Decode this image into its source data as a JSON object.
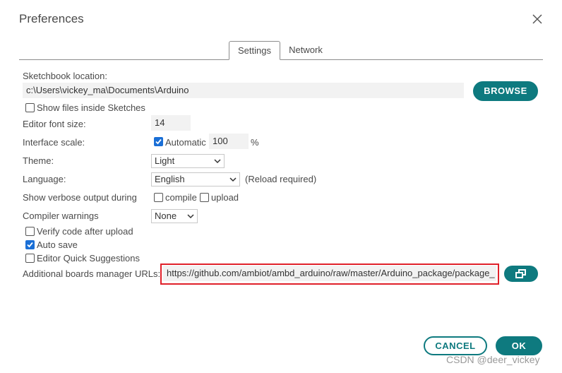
{
  "dialog": {
    "title": "Preferences",
    "close_icon": "close-icon"
  },
  "tabs": [
    {
      "label": "Settings",
      "active": true
    },
    {
      "label": "Network",
      "active": false
    }
  ],
  "settings": {
    "sketchbook_label": "Sketchbook location:",
    "sketchbook_value": "c:\\Users\\vickey_ma\\Documents\\Arduino",
    "browse_label": "BROWSE",
    "show_files_label": "Show files inside Sketches",
    "show_files_checked": false,
    "font_size_label": "Editor font size:",
    "font_size_value": "14",
    "interface_scale_label": "Interface scale:",
    "automatic_label": "Automatic",
    "automatic_checked": true,
    "scale_value": "100",
    "scale_unit": "%",
    "theme_label": "Theme:",
    "theme_value": "Light",
    "language_label": "Language:",
    "language_value": "English",
    "language_note": "(Reload required)",
    "verbose_label": "Show verbose output during",
    "compile_label": "compile",
    "compile_checked": false,
    "upload_label": "upload",
    "upload_checked": false,
    "compiler_warnings_label": "Compiler warnings",
    "compiler_warnings_value": "None",
    "verify_label": "Verify code after upload",
    "verify_checked": false,
    "autosave_label": "Auto save",
    "autosave_checked": true,
    "quick_suggestions_label": "Editor Quick Suggestions",
    "quick_suggestions_checked": false,
    "boards_urls_label": "Additional boards manager URLs:",
    "boards_urls_value": "https://github.com/ambiot/ambd_arduino/raw/master/Arduino_package/package_"
  },
  "footer": {
    "cancel_label": "CANCEL",
    "ok_label": "OK"
  },
  "watermark": "CSDN @deer_vickey",
  "colors": {
    "accent": "#0e7a7f",
    "checkbox": "#1a6fd6",
    "highlight": "#e0202a"
  }
}
